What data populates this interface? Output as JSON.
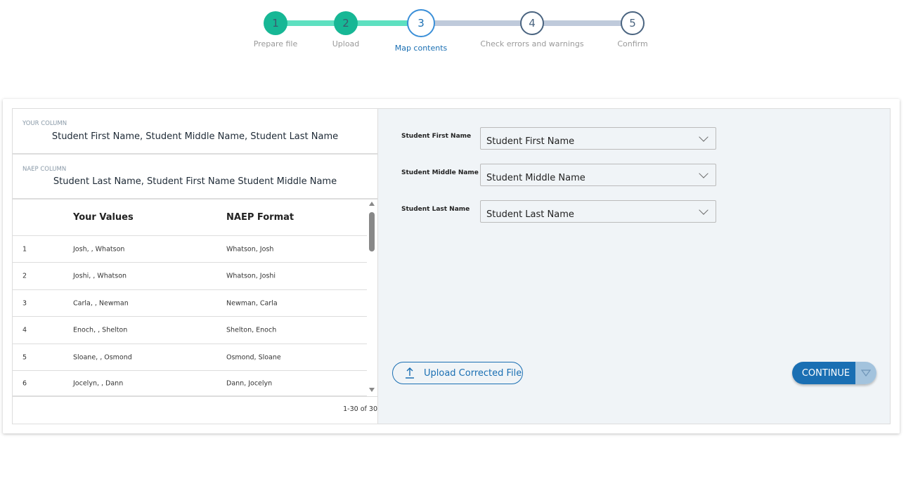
{
  "stepper": {
    "steps": [
      {
        "number": "1",
        "label": "Prepare file",
        "state": "complete"
      },
      {
        "number": "2",
        "label": "Upload",
        "state": "complete"
      },
      {
        "number": "3",
        "label": "Map contents",
        "state": "current"
      },
      {
        "number": "4",
        "label": "Check errors and warnings",
        "state": "pending"
      },
      {
        "number": "5",
        "label": "Confirm",
        "state": "pending"
      }
    ],
    "colors": {
      "complete": "#17b795",
      "complete_line": "#5de0c0",
      "current": "#3a8fd8",
      "pending": "#4a6480",
      "pending_line": "#bfcadb"
    }
  },
  "your_column": {
    "label": "YOUR COLUMN",
    "value": "Student First Name, Student Middle Name, Student Last Name"
  },
  "naep_column": {
    "label": "NAEP COLUMN",
    "value": "Student Last Name, Student First Name Student Middle Name"
  },
  "table": {
    "headers": [
      "Your Values",
      "NAEP Format"
    ],
    "rows": [
      {
        "n": "1",
        "yours": "Josh, , Whatson",
        "naep": "Whatson, Josh"
      },
      {
        "n": "2",
        "yours": "Joshi, , Whatson",
        "naep": "Whatson, Joshi"
      },
      {
        "n": "3",
        "yours": "Carla, , Newman",
        "naep": "Newman, Carla"
      },
      {
        "n": "4",
        "yours": "Enoch, , Shelton",
        "naep": "Shelton, Enoch"
      },
      {
        "n": "5",
        "yours": "Sloane, , Osmond",
        "naep": "Osmond, Sloane"
      },
      {
        "n": "6",
        "yours": "Jocelyn, , Dann",
        "naep": "Dann, Jocelyn"
      }
    ],
    "pagination": "1-30 of 30"
  },
  "mapping": [
    {
      "label": "Student First Name",
      "value": "Student First Name"
    },
    {
      "label": "Student Middle Name",
      "value": "Student Middle Name"
    },
    {
      "label": "Student Last Name",
      "value": "Student Last Name"
    }
  ],
  "buttons": {
    "upload": "Upload Corrected File",
    "continue": "CONTINUE",
    "accent": "#1a6fb3"
  }
}
